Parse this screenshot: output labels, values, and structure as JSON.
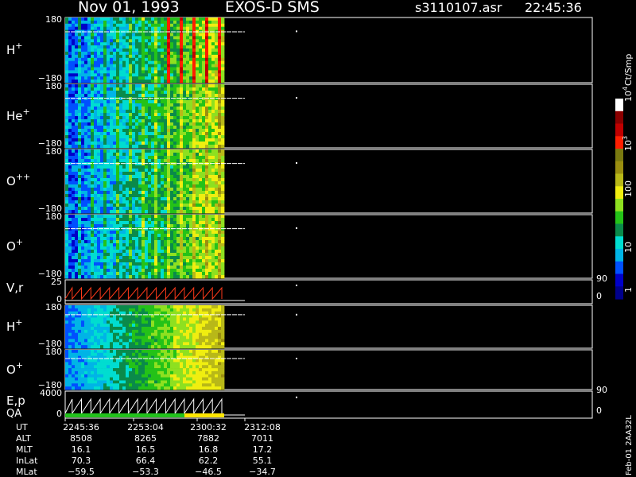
{
  "header": {
    "date": "Nov 01, 1993",
    "instrument": "EXOS-D SMS",
    "file": "s3110107.asr",
    "time": "22:45:36"
  },
  "colors": {
    "background": "#000000",
    "text": "#ffffff",
    "trace": "#ff3a1a",
    "qa_good": "#22c21c",
    "qa_warn": "#ffe600"
  },
  "colorbar": {
    "unit": "Ct/Smp",
    "ticks": [
      "1",
      "10",
      "100",
      "10",
      "10"
    ],
    "tick_exponents": [
      "",
      "",
      "",
      "3",
      "4"
    ],
    "colors": [
      "#00008b",
      "#0000c8",
      "#0050ff",
      "#00b4e6",
      "#00ddd0",
      "#0a8a4a",
      "#24c218",
      "#8ee020",
      "#f0ee10",
      "#b8b818",
      "#9a8e10",
      "#7a7a10",
      "#ff1e00",
      "#c00000",
      "#8a0000",
      "#ffffff"
    ]
  },
  "chart_data": {
    "type": "heatmap",
    "panels": [
      {
        "label": "H",
        "charge": "+",
        "y_top": "180",
        "y_bottom": "−180"
      },
      {
        "label": "He",
        "charge": "+",
        "y_top": "180",
        "y_bottom": "−180"
      },
      {
        "label": "O",
        "charge": "++",
        "y_top": "180",
        "y_bottom": "−180"
      },
      {
        "label": "O",
        "charge": "+",
        "y_top": "180",
        "y_bottom": "−180"
      },
      {
        "label": "V,r",
        "charge": "",
        "y_top": "25",
        "y_bottom": "0",
        "right_top": "90",
        "right_bottom": "0"
      },
      {
        "label": "H",
        "charge": "+",
        "y_top": "180",
        "y_bottom": "−180"
      },
      {
        "label": "O",
        "charge": "+",
        "y_top": "180",
        "y_bottom": "−180"
      },
      {
        "label": "E,p",
        "label2": "QA",
        "charge": "",
        "y_top": "4000",
        "y_bottom": "0",
        "right_top": "90",
        "right_bottom": "0"
      }
    ],
    "x_ticks": [
      "2245:36",
      "2253:04",
      "2300:32",
      "2312:08"
    ],
    "orbit_rows": [
      {
        "label": "UT",
        "values": [
          "2245:36",
          "2253:04",
          "2300:32",
          "2312:08"
        ]
      },
      {
        "label": "ALT",
        "values": [
          "8508",
          "8265",
          "7882",
          "7011"
        ]
      },
      {
        "label": "MLT",
        "values": [
          "16.1",
          "16.5",
          "16.8",
          "17.2"
        ]
      },
      {
        "label": "InLat",
        "values": [
          "70.3",
          "66.4",
          "62.2",
          "55.1"
        ]
      },
      {
        "label": "MLat",
        "values": [
          "−59.5",
          "−53.3",
          "−46.5",
          "−34.7"
        ]
      }
    ],
    "side_label": "Feb-01 2AA32L"
  }
}
